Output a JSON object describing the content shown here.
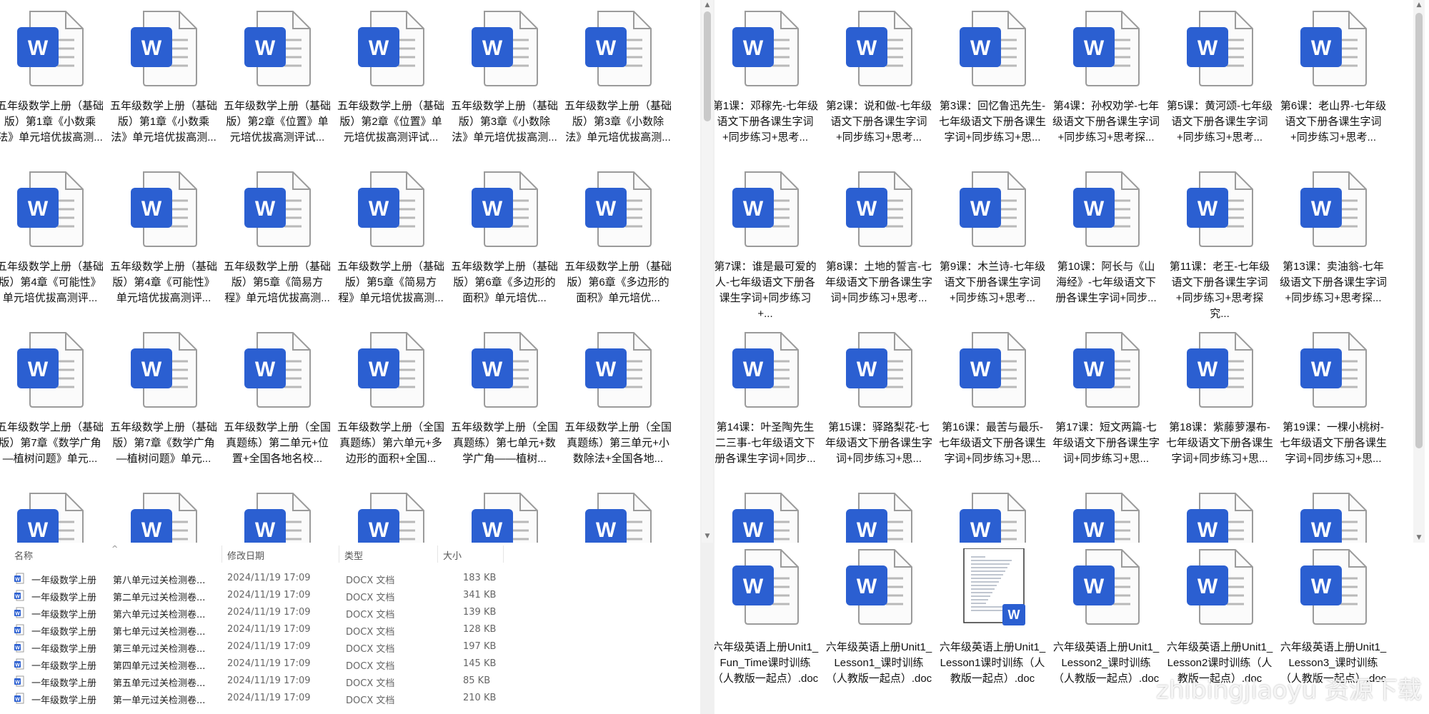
{
  "left_pane": {
    "files": [
      "五年级数学上册（基础版）第1章《小数乘法》单元培优拔高测...",
      "五年级数学上册（基础版）第1章《小数乘法》单元培优拔高测...",
      "五年级数学上册（基础版）第2章《位置》单元培优拔高测评试...",
      "五年级数学上册（基础版）第2章《位置》单元培优拔高测评试...",
      "五年级数学上册（基础版）第3章《小数除法》单元培优拔高测...",
      "五年级数学上册（基础版）第3章《小数除法》单元培优拔高测...",
      "五年级数学上册（基础版）第4章《可能性》单元培优拔高测评...",
      "五年级数学上册（基础版）第4章《可能性》单元培优拔高测评...",
      "五年级数学上册（基础版）第5章《简易方程》单元培优拔高测...",
      "五年级数学上册（基础版）第5章《简易方程》单元培优拔高测...",
      "五年级数学上册（基础版）第6章《多边形的面积》单元培优...",
      "五年级数学上册（基础版）第6章《多边形的面积》单元培优...",
      "五年级数学上册（基础版）第7章《数学广角—植树问题》单元...",
      "五年级数学上册（基础版）第7章《数学广角—植树问题》单元...",
      "五年级数学上册（全国真题练）第二单元+位置+全国各地名校...",
      "五年级数学上册（全国真题练）第六单元+多边形的面积+全国...",
      "五年级数学上册（全国真题练）第七单元+数学广角——植树...",
      "五年级数学上册（全国真题练）第三单元+小数除法+全国各地..."
    ]
  },
  "right_pane": {
    "files": [
      "第1课：邓稼先-七年级语文下册各课生字词+同步练习+思考...",
      "第2课：说和做-七年级语文下册各课生字词+同步练习+思考...",
      "第3课：回忆鲁迅先生-七年级语文下册各课生字词+同步练习+思...",
      "第4课：孙权劝学-七年级语文下册各课生字词+同步练习+思考探...",
      "第5课：黄河颂-七年级语文下册各课生字词+同步练习+思考...",
      "第6课：老山界-七年级语文下册各课生字词+同步练习+思考...",
      "第7课：谁是最可爱的人-七年级语文下册各课生字词+同步练习+...",
      "第8课：土地的誓言-七年级语文下册各课生字词+同步练习+思考...",
      "第9课：木兰诗-七年级语文下册各课生字词+同步练习+思考...",
      "第10课：阿长与《山海经》-七年级语文下册各课生字词+同步...",
      "第11课：老王-七年级语文下册各课生字词+同步练习+思考探究...",
      "第13课：卖油翁-七年级语文下册各课生字词+同步练习+思考探...",
      "第14课：叶圣陶先生二三事-七年级语文下册各课生字词+同步...",
      "第15课：驿路梨花-七年级语文下册各课生字词+同步练习+思...",
      "第16课：最苦与最乐-七年级语文下册各课生字词+同步练习+思...",
      "第17课：短文两篇-七年级语文下册各课生字词+同步练习+思...",
      "第18课：紫藤萝瀑布-七年级语文下册各课生字词+同步练习+思...",
      "第19课：一棵小桃树-七年级语文下册各课生字词+同步练习+思..."
    ]
  },
  "details": {
    "headers": {
      "name": "名称",
      "modified": "修改日期",
      "type": "类型",
      "size": "大小"
    },
    "rows": [
      {
        "name": "一年级数学上册",
        "detail": "第八单元过关检测卷...",
        "date": "2024/11/19 17:09",
        "type": "DOCX 文档",
        "size": "183 KB"
      },
      {
        "name": "一年级数学上册",
        "detail": "第二单元过关检测卷...",
        "date": "2024/11/19 17:09",
        "type": "DOCX 文档",
        "size": "341 KB"
      },
      {
        "name": "一年级数学上册",
        "detail": "第六单元过关检测卷...",
        "date": "2024/11/19 17:09",
        "type": "DOCX 文档",
        "size": "139 KB"
      },
      {
        "name": "一年级数学上册",
        "detail": "第七单元过关检测卷...",
        "date": "2024/11/19 17:09",
        "type": "DOCX 文档",
        "size": "128 KB"
      },
      {
        "name": "一年级数学上册",
        "detail": "第三单元过关检测卷...",
        "date": "2024/11/19 17:09",
        "type": "DOCX 文档",
        "size": "197 KB"
      },
      {
        "name": "一年级数学上册",
        "detail": "第四单元过关检测卷...",
        "date": "2024/11/19 17:09",
        "type": "DOCX 文档",
        "size": "145 KB"
      },
      {
        "name": "一年级数学上册",
        "detail": "第五单元过关检测卷...",
        "date": "2024/11/19 17:09",
        "type": "DOCX 文档",
        "size": "85 KB"
      },
      {
        "name": "一年级数学上册",
        "detail": "第一单元过关检测卷...",
        "date": "2024/11/19 17:09",
        "type": "DOCX 文档",
        "size": "210 KB"
      }
    ]
  },
  "english_pane": {
    "files": [
      "六年级英语上册Unit1_Fun_Time课时训练（人教版一起点）.doc",
      "六年级英语上册Unit1_Lesson1_课时训练（人教版一起点）.doc",
      "六年级英语上册Unit1_Lesson1课时训练（人教版一起点）.doc",
      "六年级英语上册Unit1_Lesson2_课时训练（人教版一起点）.doc",
      "六年级英语上册Unit1_Lesson2课时训练（人教版一起点）.doc",
      "六年级英语上册Unit1_Lesson3_课时训练（人教版一起点）.doc"
    ]
  },
  "watermark": "zhibingjiaoyu 资源下载",
  "colors": {
    "word_blue": "#2b5fd1",
    "word_blue_dark": "#1f4ebd",
    "page_bg": "#ffffff"
  }
}
